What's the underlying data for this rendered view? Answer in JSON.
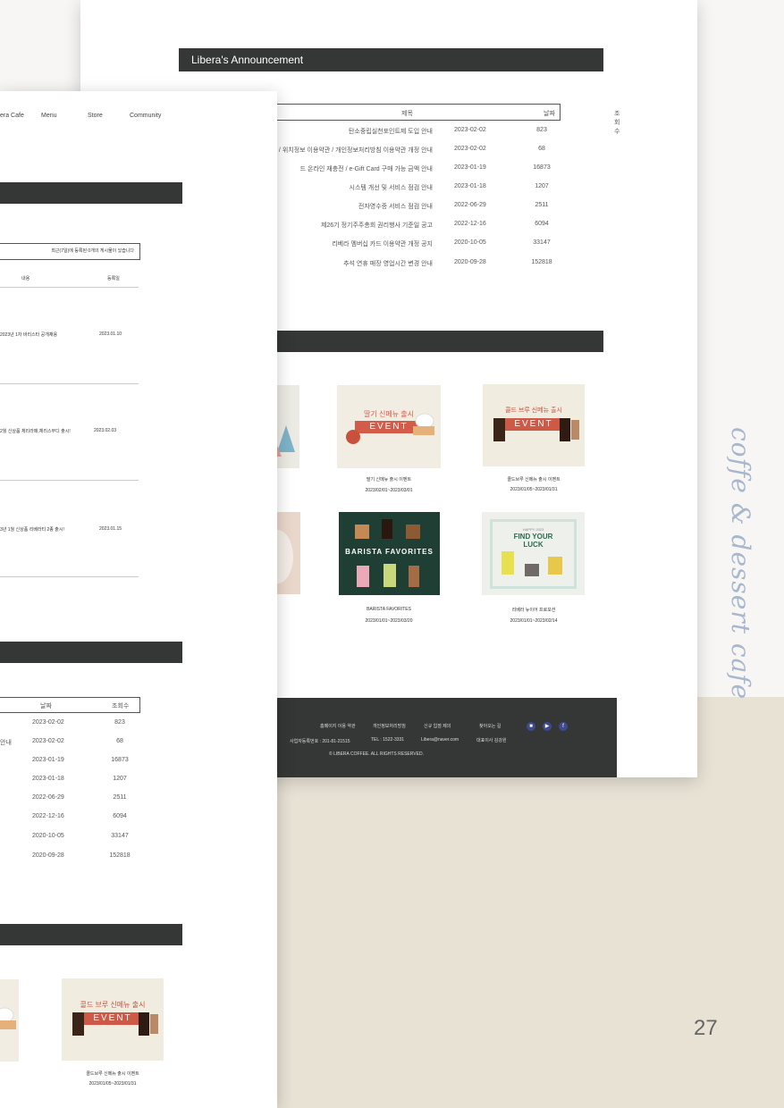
{
  "announcement": {
    "heading": "Libera's Announcement",
    "columns": {
      "title": "제목",
      "date": "날짜",
      "views": "조회수"
    },
    "rows": [
      {
        "title": "탄소중립실천포인트제 도입 안내",
        "date": "2023-02-02",
        "views": "823"
      },
      {
        "title": "관방침 / 위치정보 이용약관 / 개인정보처리방침 이용약관 개정 안내",
        "date": "2023-02-02",
        "views": "68"
      },
      {
        "title": "드 온라인 재충전 / e-Gift Card 구매 가능 금액 안내",
        "date": "2023-01-19",
        "views": "16873"
      },
      {
        "title": "시스템 개선 및 서비스 점검 안내",
        "date": "2023-01-18",
        "views": "1207"
      },
      {
        "title": "전자영수증 서비스 점검 안내",
        "date": "2022-06-29",
        "views": "2511"
      },
      {
        "title": "제26기 정기주주총회 권리행사 기준일 공고",
        "date": "2022-12-16",
        "views": "6094"
      },
      {
        "title": "리베라 멤버십 카드 이용약관 개정 공지",
        "date": "2020-10-05",
        "views": "33147"
      },
      {
        "title": "추석 연휴 매장 영업시간 변경 안내",
        "date": "2020-09-28",
        "views": "152818"
      }
    ]
  },
  "events": [
    {
      "banner_title": "딸기 신메뉴 출시",
      "banner_event": "EVENT",
      "caption": "딸기 신메뉴 출시 이벤트",
      "period": "2023/02/01~2023/03/01"
    },
    {
      "banner_title": "콜드 브루 신메뉴 출시",
      "banner_event": "EVENT",
      "caption": "콜드브루 신메뉴 출시 이벤트",
      "period": "2023/01/05~2023/01/31"
    },
    {
      "banner_title": "BARISTA FAVORITES",
      "caption": "BARISTA FAVORITES",
      "period": "2023/01/01~2023/03/20"
    },
    {
      "banner_small": "HAPPY 2023",
      "banner_title_1": "FIND YOUR",
      "banner_title_2": "LUCK",
      "caption": "리베라 뉴이어 프로모션",
      "period": "2023/01/01~2023/02/14"
    }
  ],
  "footer": {
    "links": [
      "홈페이지 이용 약관",
      "개인정보처리방침",
      "신규 입점 제의",
      "찾아오는 길"
    ],
    "business_no": "사업자등록번호 : 201-81-21515",
    "tel": "TEL : 1522-3331",
    "email": "Libera@naver.com",
    "ceo": "대표이사 김강원",
    "copyright": "© LIBERA COFFEE. ALL RIGHTS RESERVED.",
    "sns": [
      "chat-icon",
      "youtube-icon",
      "facebook-icon"
    ]
  },
  "front": {
    "nav": [
      "era Cafe",
      "Menu",
      "Store",
      "Community"
    ],
    "notice": "최근(7일)에 등록된 0개의 게시물이 있습니다",
    "columns": {
      "content": "내용",
      "reg_date": "등록일"
    },
    "news": [
      {
        "content": "2023년 1차 바리스타 공개채용",
        "date": "2023.01.10"
      },
      {
        "content": "2월 신상품 체리라떼,체리스무디 출시!",
        "date": "2023.02.03"
      },
      {
        "content": "3년 1월 신상품 리베라티 2종 출시!",
        "date": "2023.01.15"
      }
    ],
    "table_cols": {
      "date": "날짜",
      "views": "조회수"
    },
    "table_rows": [
      {
        "title": "",
        "date": "2023-02-02",
        "views": "823"
      },
      {
        "title": "안내",
        "date": "2023-02-02",
        "views": "68"
      },
      {
        "title": "",
        "date": "2023-01-19",
        "views": "16873"
      },
      {
        "title": "",
        "date": "2023-01-18",
        "views": "1207"
      },
      {
        "title": "",
        "date": "2022-06-29",
        "views": "2511"
      },
      {
        "title": "",
        "date": "2022-12-16",
        "views": "6094"
      },
      {
        "title": "",
        "date": "2020-10-05",
        "views": "33147"
      },
      {
        "title": "",
        "date": "2020-09-28",
        "views": "152818"
      }
    ],
    "event": {
      "banner_title": "콜드 브루 신메뉴 출시",
      "banner_event": "EVENT",
      "caption": "콜드브루 신메뉴 출시 이벤트",
      "period": "2023/01/05~2023/01/31"
    }
  },
  "side_text": "coffe & dessert cafe",
  "page_number": "27"
}
